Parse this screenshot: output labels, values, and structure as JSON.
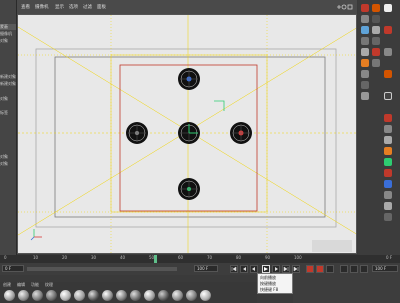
{
  "left_panel": {
    "items": [
      "蒙蔽",
      "摄像机",
      "对象",
      "新建对象",
      "新建对象",
      "对象",
      "标签",
      "对象",
      "对象"
    ]
  },
  "viewport_menu": [
    "查看",
    "摄像机",
    "显示",
    "选项",
    "过滤",
    "面板"
  ],
  "timeline": {
    "ticks": [
      "0",
      "10",
      "20",
      "30",
      "40",
      "50",
      "60",
      "70",
      "80",
      "90",
      "100"
    ],
    "current_frame_marker": "0 F"
  },
  "transport": {
    "start_field": "0 F",
    "end_field": "100 F",
    "current_field": "0 F",
    "fps_field": "100 F"
  },
  "tooltip": {
    "title": "向前播放",
    "line1": "按键播放",
    "line2": "快捷键 F8"
  },
  "material_bar": {
    "tabs": [
      "创建",
      "编辑",
      "功能",
      "纹理"
    ]
  },
  "colors": {
    "viewport_bg": "#e8e8e8",
    "safe_frame_red": "#c0392b",
    "guide_yellow": "#f1d400",
    "axis_green": "#2ecc71"
  }
}
